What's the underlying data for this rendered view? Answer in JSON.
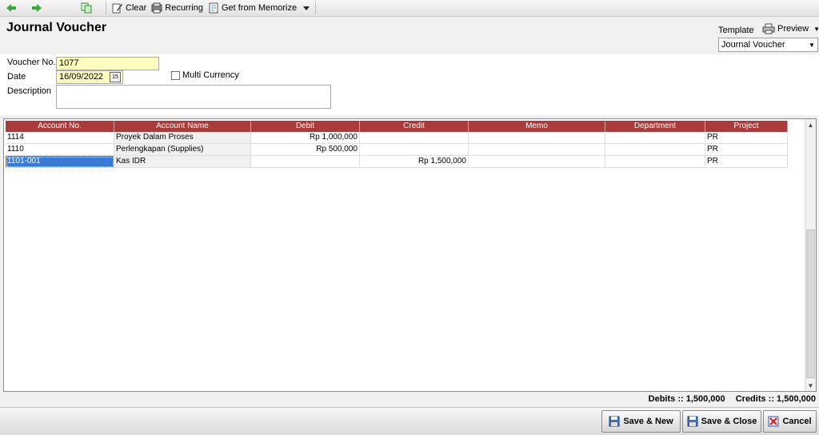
{
  "toolbar": {
    "back_icon": "arrow-left-icon",
    "forward_icon": "arrow-right-icon",
    "copy_icon": "copy-icon",
    "clear_label": "Clear",
    "recurring_label": "Recurring",
    "memorize_label": "Get from Memorize"
  },
  "header": {
    "title": "Journal Voucher",
    "template_label": "Template",
    "preview_label": "Preview",
    "template_value": "Journal Voucher"
  },
  "form": {
    "voucher_label": "Voucher No.",
    "voucher_value": "1077",
    "date_label": "Date",
    "date_value": "16/09/2022",
    "multi_currency_label": "Multi Currency",
    "multi_currency_checked": false,
    "description_label": "Description",
    "description_value": ""
  },
  "grid": {
    "columns": [
      "Account No.",
      "Account Name",
      "Debit",
      "Credit",
      "Memo",
      "Department",
      "Project"
    ],
    "rows": [
      [
        "1114",
        "Proyek Dalam Proses",
        "Rp 1,000,000",
        "",
        "",
        "",
        "PR"
      ],
      [
        "1110",
        "Perlengkapan (Supplies)",
        "Rp 500,000",
        "",
        "",
        "",
        "PR"
      ],
      [
        "1101-001",
        "Kas IDR",
        "",
        "Rp 1,500,000",
        "",
        "",
        "PR"
      ]
    ],
    "selected_row": 2
  },
  "totals": {
    "debits": "Debits :: 1,500,000",
    "credits": "Credits :: 1,500,000"
  },
  "footer": {
    "save_new_label": "Save & New",
    "save_close_label": "Save & Close",
    "cancel_label": "Cancel"
  },
  "colors": {
    "header_red": "#a83b3b",
    "input_yellow": "#ffffc0",
    "selection_blue": "#3a7ad4",
    "nav_green": "#3aa83a"
  }
}
